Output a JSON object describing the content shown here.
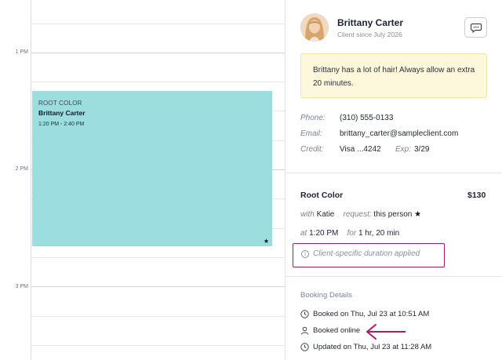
{
  "calendar": {
    "time_labels": {
      "t1": "1 PM",
      "t2": "2 PM",
      "t3": "3 PM"
    },
    "appointment": {
      "service": "ROOT COLOR",
      "client": "Brittany Carter",
      "time": "1:20 PM - 2:40 PM",
      "color": "#9cdde0"
    }
  },
  "client": {
    "name": "Brittany Carter",
    "since": "Client since July 2026",
    "note": "Brittany has a lot of hair! Always allow an  extra 20 minutes.",
    "phone_label": "Phone:",
    "phone": "(310) 555-0133",
    "email_label": "Email:",
    "email": "brittany_carter@sampleclient.com",
    "credit_label": "Credit:",
    "credit": "Visa  ...4242",
    "exp_label": "Exp:",
    "exp": "3/29"
  },
  "service": {
    "name": "Root Color",
    "price": "$130",
    "with_label": "with",
    "staff": "Katie",
    "request_label": "request:",
    "request": "this person",
    "at_label": "at",
    "start_time": "1:20 PM",
    "for_label": "for",
    "duration": "1 hr, 20 min",
    "duration_note": "Client-specific duration applied"
  },
  "booking": {
    "title": "Booking Details",
    "booked_on": "Booked on Thu, Jul 23 at 10:51 AM",
    "channel": "Booked online",
    "updated_on": "Updated on Thu, Jul 23 at 11:28 AM"
  },
  "colors": {
    "highlight": "#b0186c",
    "note_bg": "#fdf8dc"
  },
  "icons": [
    "chat-bubble-icon",
    "star-icon",
    "info-icon",
    "clock-icon",
    "person-icon",
    "arrow-left-icon"
  ]
}
